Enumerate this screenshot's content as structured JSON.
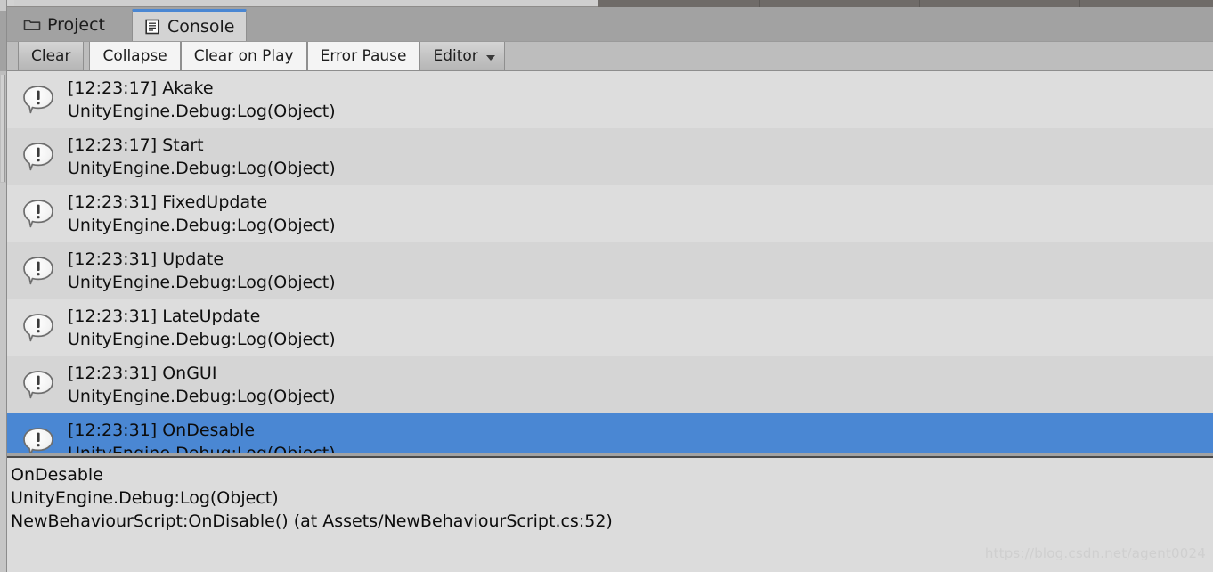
{
  "window": {
    "background_color": "#a2a2a2"
  },
  "tabs": [
    {
      "label": "Project",
      "icon": "folder-icon",
      "active": false
    },
    {
      "label": "Console",
      "icon": "console-document-icon",
      "active": true
    }
  ],
  "toolbar": {
    "buttons": [
      {
        "label": "Clear",
        "style": "shaded",
        "dropdown": false
      },
      {
        "label": "Collapse",
        "style": "light",
        "dropdown": false
      },
      {
        "label": "Clear on Play",
        "style": "light",
        "dropdown": false
      },
      {
        "label": "Error Pause",
        "style": "light",
        "dropdown": false
      },
      {
        "label": "Editor",
        "style": "shaded",
        "dropdown": true
      }
    ]
  },
  "console": {
    "accent_color": "#4a87d3",
    "row_even_color": "#dddddd",
    "row_odd_color": "#d5d5d5",
    "entries": [
      {
        "icon": "log-info-icon",
        "message": "[12:23:17] Akake",
        "stack": "UnityEngine.Debug:Log(Object)",
        "selected": false
      },
      {
        "icon": "log-info-icon",
        "message": "[12:23:17] Start",
        "stack": "UnityEngine.Debug:Log(Object)",
        "selected": false
      },
      {
        "icon": "log-info-icon",
        "message": "[12:23:31] FixedUpdate",
        "stack": "UnityEngine.Debug:Log(Object)",
        "selected": false
      },
      {
        "icon": "log-info-icon",
        "message": "[12:23:31] Update",
        "stack": "UnityEngine.Debug:Log(Object)",
        "selected": false
      },
      {
        "icon": "log-info-icon",
        "message": "[12:23:31] LateUpdate",
        "stack": "UnityEngine.Debug:Log(Object)",
        "selected": false
      },
      {
        "icon": "log-info-icon",
        "message": "[12:23:31] OnGUI",
        "stack": "UnityEngine.Debug:Log(Object)",
        "selected": false
      },
      {
        "icon": "log-info-icon",
        "message": "[12:23:31] OnDesable",
        "stack": "UnityEngine.Debug:Log(Object)",
        "selected": true
      }
    ]
  },
  "detail": {
    "lines": [
      "OnDesable",
      "UnityEngine.Debug:Log(Object)",
      "NewBehaviourScript:OnDisable() (at Assets/NewBehaviourScript.cs:52)"
    ]
  },
  "watermark": {
    "text": "https://blog.csdn.net/agent0024"
  }
}
